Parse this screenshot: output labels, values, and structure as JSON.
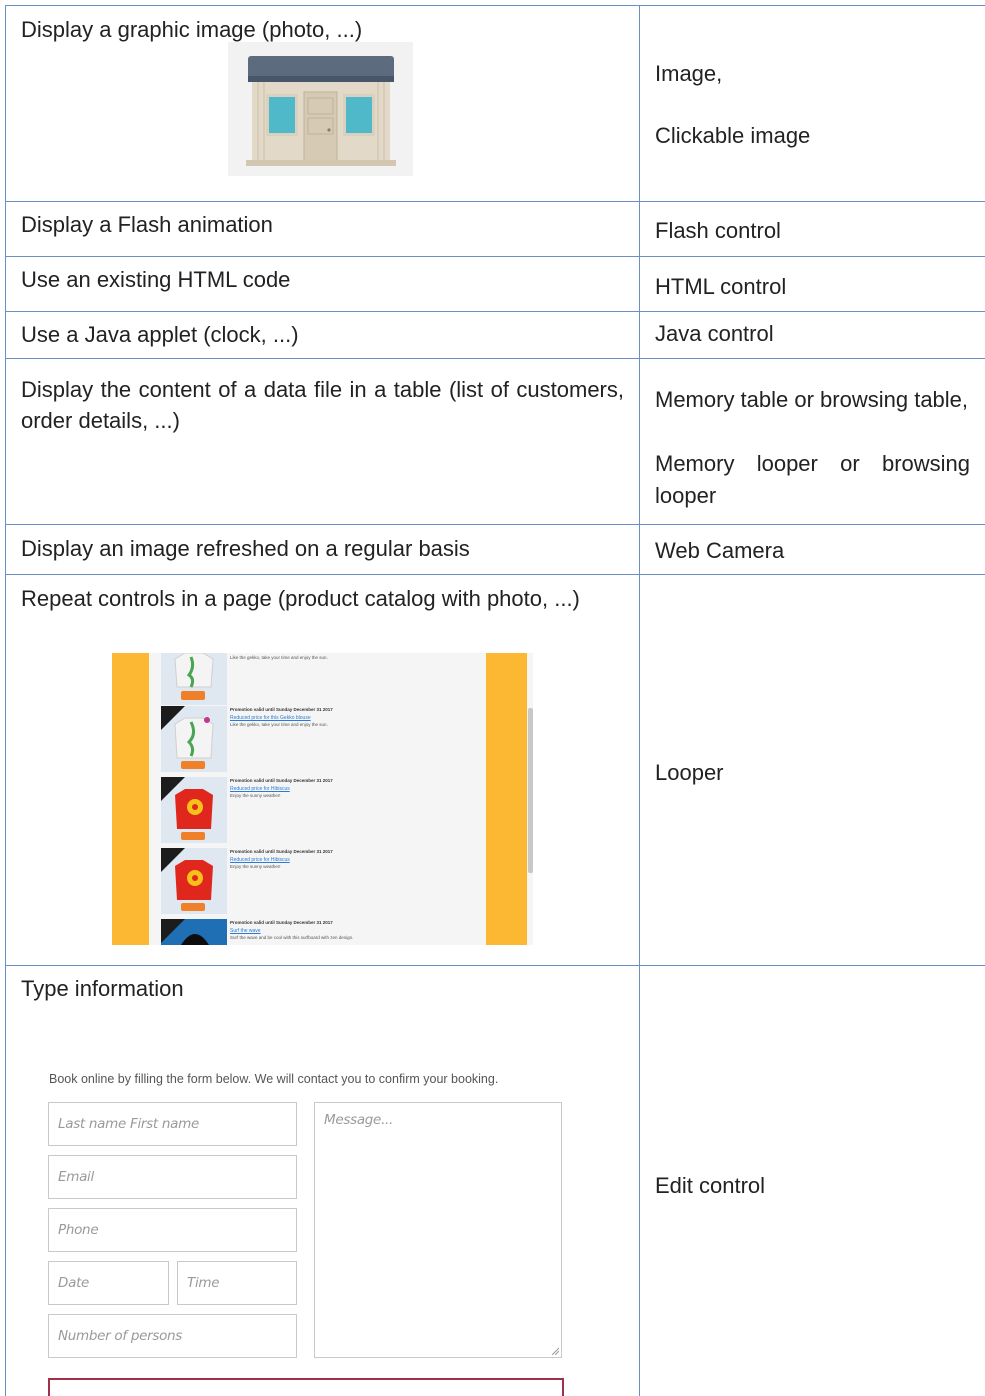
{
  "rows": [
    {
      "left": "Display a graphic image (photo, ...)",
      "right_lines": [
        "Image,",
        "Clickable image"
      ]
    },
    {
      "left": "Display a Flash animation",
      "right": "Flash control"
    },
    {
      "left": "Use an existing HTML code",
      "right": "HTML control"
    },
    {
      "left": "Use a Java applet (clock, ...)",
      "right": "Java control"
    },
    {
      "left": "Display the content of a data file in a table (list of customers, order details, ...)",
      "right_lines": [
        "Memory table or browsing table,",
        "Memory looper or browsing looper"
      ]
    },
    {
      "left": "Display an image refreshed on a regular basis",
      "right": "Web Camera"
    },
    {
      "left": "Repeat controls in a page (product catalog with photo, ...)",
      "right": "Looper"
    },
    {
      "left": "Type information",
      "right": "Edit control"
    }
  ],
  "looper": {
    "items": [
      {
        "promo": "",
        "link": "",
        "desc": "Like the gekko, take your time and enjoy the sun."
      },
      {
        "promo": "Promotion valid until Sunday December 31 2017",
        "link": "Reduced price for this Gekko blouse",
        "desc": "Like the gekko, take your time and enjoy the sun."
      },
      {
        "promo": "Promotion valid until Sunday December 31 2017",
        "link": "Reduced price for Hibiscus",
        "desc": "Enjoy the sunny weather!"
      },
      {
        "promo": "Promotion valid until Sunday December 31 2017",
        "link": "Reduced price for Hibiscus",
        "desc": "Enjoy the sunny weather!"
      },
      {
        "promo": "Promotion valid until Sunday December 31 2017",
        "link": "Surf the wave",
        "desc": "Surf the wave and be cool with this surfboard with zen design."
      }
    ]
  },
  "form": {
    "intro": "Book online by filling the form below. We will contact you to confirm your booking.",
    "name_placeholder": "Last name First name",
    "email_placeholder": "Email",
    "phone_placeholder": "Phone",
    "date_placeholder": "Date",
    "time_placeholder": "Time",
    "persons_placeholder": "Number of persons",
    "message_placeholder": "Message..."
  },
  "colors": {
    "border": "#6a8fc4",
    "looper_side": "#fcb832",
    "link": "#2a7bd6",
    "submit_border": "#a3304a"
  }
}
